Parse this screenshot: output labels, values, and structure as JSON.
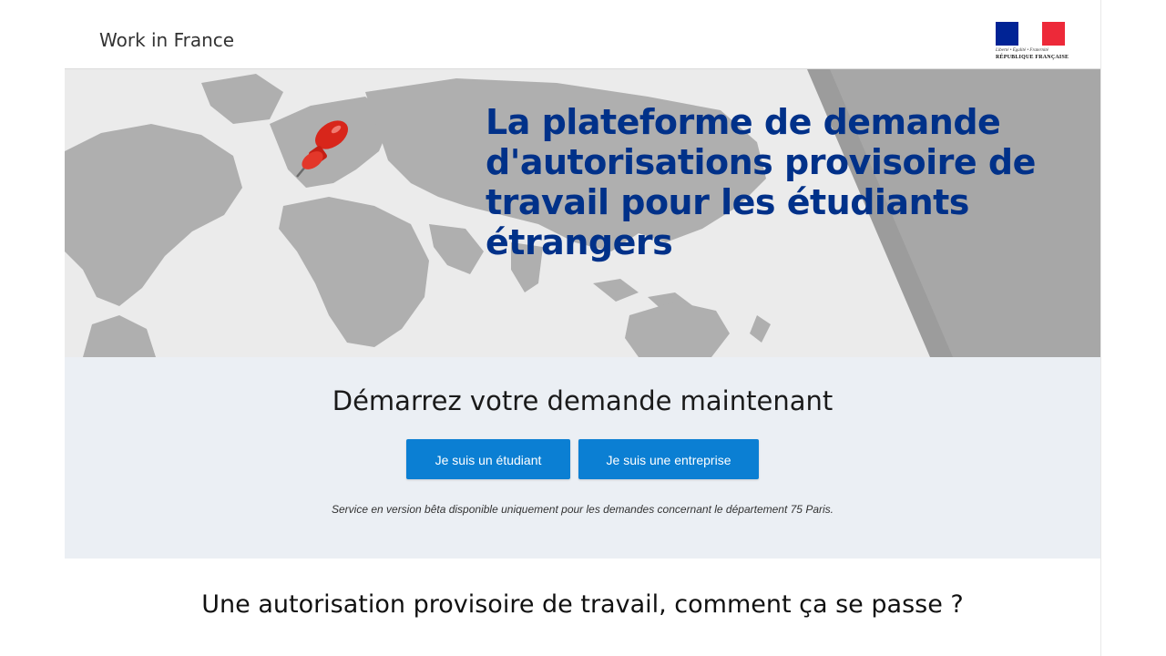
{
  "header": {
    "site_title": "Work in France",
    "logo": {
      "motto": "Liberté • Égalité • Fraternité",
      "name": "RÉPUBLIQUE FRANÇAISE",
      "colors": [
        "#002395",
        "#ffffff",
        "#ed2939"
      ]
    }
  },
  "hero": {
    "title": "La plateforme de demande d'autorisations provisoire de travail pour les étudiants étrangers",
    "title_color": "#003189",
    "image": "world-map-with-red-pushpin"
  },
  "cta": {
    "title": "Démarrez votre demande maintenant",
    "student_button": "Je suis un étudiant",
    "company_button": "Je suis une entreprise",
    "note": "Service en version bêta disponible uniquement pour les demandes concernant le département 75 Paris.",
    "button_color": "#0b7fd3"
  },
  "section": {
    "title": "Une autorisation provisoire de travail, comment ça se passe ?"
  }
}
